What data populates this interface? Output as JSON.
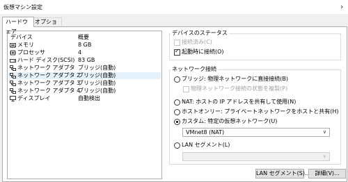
{
  "window": {
    "title": "仮想マシン設定"
  },
  "tabs": [
    {
      "label": "ハードウェア",
      "active": true
    },
    {
      "label": "オプション",
      "active": false
    }
  ],
  "device_list": {
    "columns": [
      "デバイス",
      "概要"
    ],
    "rows": [
      {
        "icon": "memory-icon",
        "name": "メモリ",
        "summary": "8 GB",
        "selected": false
      },
      {
        "icon": "processor-icon",
        "name": "プロセッサ",
        "summary": "4",
        "selected": false
      },
      {
        "icon": "hard-disk-icon",
        "name": "ハード ディスク(SCSI)",
        "summary": "83 GB",
        "selected": false
      },
      {
        "icon": "network-adapter-icon",
        "name": "ネットワーク アダプタ",
        "summary": "ブリッジ(自動)",
        "selected": false
      },
      {
        "icon": "network-adapter-icon",
        "name": "ネットワーク アダプタ 2",
        "summary": "ブリッジ(自動)",
        "selected": true
      },
      {
        "icon": "network-adapter-icon",
        "name": "ネットワーク アダプタ 3",
        "summary": "ブリッジ(自動)",
        "selected": false
      },
      {
        "icon": "network-adapter-icon",
        "name": "ネットワーク アダプタ 4",
        "summary": "ブリッジ(自動)",
        "selected": false
      },
      {
        "icon": "display-icon",
        "name": "ディスプレイ",
        "summary": "自動検出",
        "selected": false
      }
    ]
  },
  "device_status": {
    "title": "デバイスのステータス",
    "connected": {
      "label": "接続済み(C)",
      "checked": false,
      "enabled": false
    },
    "connect_at_power_on": {
      "label": "起動時に接続(O)",
      "checked": true,
      "enabled": true
    }
  },
  "network_connection": {
    "title": "ネットワーク接続",
    "options": [
      {
        "label": "ブリッジ: 物理ネットワークに直接接続(B)",
        "selected": false
      },
      {
        "label": "NAT: ホストの IP アドレスを共有して使用(N)",
        "selected": false
      },
      {
        "label": "ホストオンリー: プライベートネットワークをホストと共有(H)",
        "selected": false
      },
      {
        "label": "カスタム: 特定の仮想ネットワーク(U)",
        "selected": true
      },
      {
        "label": "LAN セグメント(L)",
        "selected": false
      }
    ],
    "replicate_state": {
      "label": "物理ネットワーク接続の状態を複製(P)",
      "checked": false,
      "enabled": false
    },
    "custom_network_value": "VMnet8 (NAT)",
    "lan_segment_value": ""
  },
  "buttons": {
    "lan_segments": "LAN セグメント(S)...",
    "advanced": "詳細(V)..."
  },
  "icons": {
    "collapse": "chevron-right-icon"
  }
}
